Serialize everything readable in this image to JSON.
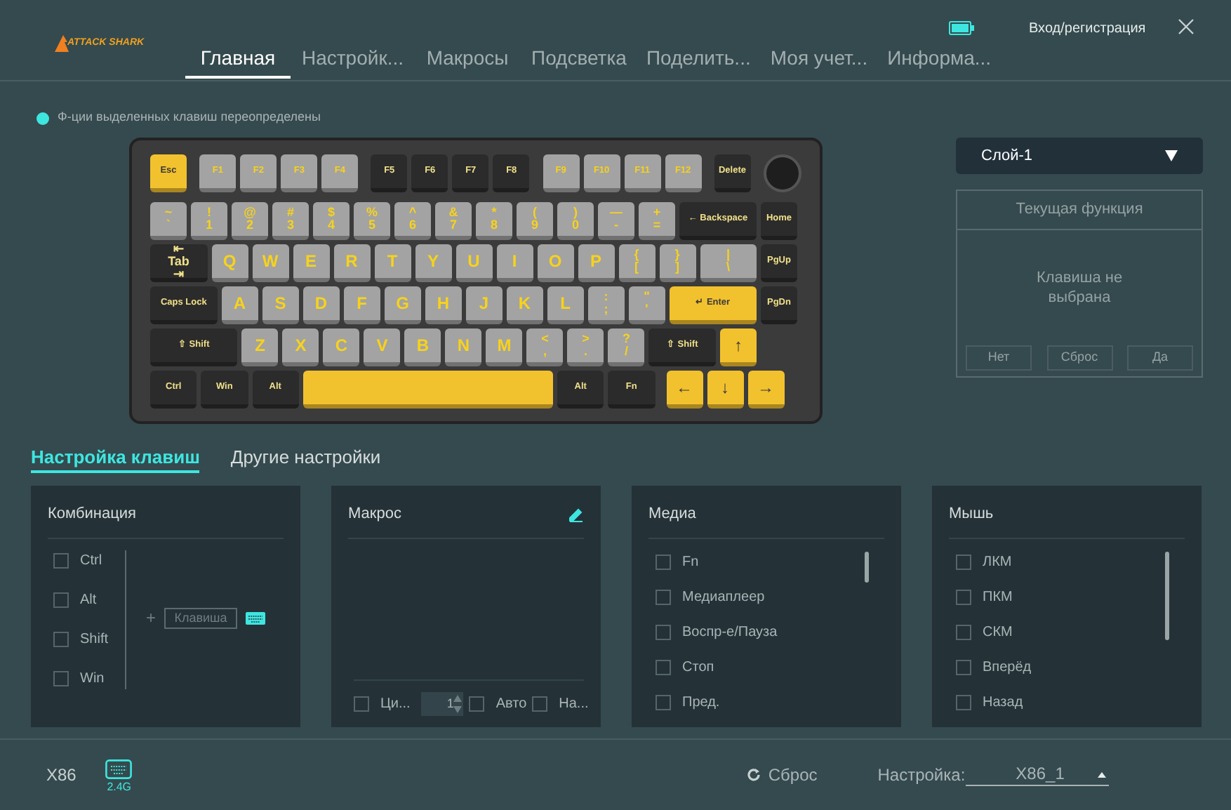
{
  "header": {
    "logo": "ATTACK SHARK",
    "login": "Вход/регистрация",
    "tabs": [
      {
        "label": "Главная",
        "selected": true
      },
      {
        "label": "Настройк...",
        "selected": false
      },
      {
        "label": "Макросы",
        "selected": false
      },
      {
        "label": "Подсветка",
        "selected": false
      },
      {
        "label": "Поделить...",
        "selected": false
      },
      {
        "label": "Моя учет...",
        "selected": false
      },
      {
        "label": "Информа...",
        "selected": false
      }
    ]
  },
  "notice": {
    "text": "Ф-ции выделенных клавиш переопределены",
    "color": "#3ee6e0"
  },
  "keyboard": {
    "rows": [
      {
        "clusters": [
          {
            "keys": [
              {
                "legend": [
                  "Esc"
                ],
                "kind": "standard",
                "color": "#f2c12e"
              }
            ]
          },
          {
            "keys": [
              {
                "legend": [
                  "F1"
                ],
                "kind": "standard",
                "color": "#a3a3a3"
              },
              {
                "legend": [
                  "F2"
                ],
                "kind": "standard",
                "color": "#a3a3a3"
              },
              {
                "legend": [
                  "F3"
                ],
                "kind": "standard",
                "color": "#a3a3a3"
              },
              {
                "legend": [
                  "F4"
                ],
                "kind": "standard",
                "color": "#a3a3a3"
              }
            ]
          },
          {
            "keys": [
              {
                "legend": [
                  "F5"
                ],
                "kind": "standard",
                "color": "#2b2b2b"
              },
              {
                "legend": [
                  "F6"
                ],
                "kind": "standard",
                "color": "#2b2b2b"
              },
              {
                "legend": [
                  "F7"
                ],
                "kind": "standard",
                "color": "#2b2b2b"
              },
              {
                "legend": [
                  "F8"
                ],
                "kind": "standard",
                "color": "#2b2b2b"
              }
            ]
          },
          {
            "keys": [
              {
                "legend": [
                  "F9"
                ],
                "kind": "standard",
                "color": "#a3a3a3"
              },
              {
                "legend": [
                  "F10"
                ],
                "kind": "standard",
                "color": "#a3a3a3"
              },
              {
                "legend": [
                  "F11"
                ],
                "kind": "standard",
                "color": "#a3a3a3"
              },
              {
                "legend": [
                  "F12"
                ],
                "kind": "standard",
                "color": "#a3a3a3"
              }
            ]
          },
          {
            "keys": [
              {
                "legend": [
                  "Delete"
                ],
                "kind": "standard",
                "color": "#2b2b2b"
              }
            ]
          }
        ]
      },
      {
        "clusters": [
          {
            "keys": [
              {
                "legend": [
                  "~",
                  "`"
                ],
                "kind": "standard",
                "color": "#a3a3a3"
              },
              {
                "legend": [
                  "!",
                  "1"
                ],
                "kind": "standard",
                "color": "#a3a3a3"
              },
              {
                "legend": [
                  "@",
                  "2"
                ],
                "kind": "standard",
                "color": "#a3a3a3"
              },
              {
                "legend": [
                  "#",
                  "3"
                ],
                "kind": "standard",
                "color": "#a3a3a3"
              },
              {
                "legend": [
                  "$",
                  "4"
                ],
                "kind": "standard",
                "color": "#a3a3a3"
              },
              {
                "legend": [
                  "%",
                  "5"
                ],
                "kind": "standard",
                "color": "#a3a3a3"
              },
              {
                "legend": [
                  "^",
                  "6"
                ],
                "kind": "standard",
                "color": "#a3a3a3"
              },
              {
                "legend": [
                  "&",
                  "7"
                ],
                "kind": "standard",
                "color": "#a3a3a3"
              },
              {
                "legend": [
                  "*",
                  "8"
                ],
                "kind": "standard",
                "color": "#a3a3a3"
              },
              {
                "legend": [
                  "(",
                  "9"
                ],
                "kind": "standard",
                "color": "#a3a3a3"
              },
              {
                "legend": [
                  ")",
                  "0"
                ],
                "kind": "standard",
                "color": "#a3a3a3"
              },
              {
                "legend": [
                  "—",
                  "-"
                ],
                "kind": "standard",
                "color": "#a3a3a3"
              },
              {
                "legend": [
                  "+",
                  "="
                ],
                "kind": "standard",
                "color": "#a3a3a3"
              },
              {
                "legend": [
                  "← Backspace"
                ],
                "kind": "backspace",
                "color": "#2b2b2b"
              },
              {
                "legend": [
                  "Home"
                ],
                "kind": "standard",
                "color": "#2b2b2b"
              }
            ]
          }
        ]
      },
      {
        "clusters": [
          {
            "keys": [
              {
                "legend": [
                  "⇤",
                  "Tab",
                  "⇥"
                ],
                "kind": "tab",
                "color": "#2b2b2b"
              },
              {
                "legend": [
                  "Q"
                ],
                "kind": "standard",
                "color": "#a3a3a3"
              },
              {
                "legend": [
                  "W"
                ],
                "kind": "standard",
                "color": "#a3a3a3"
              },
              {
                "legend": [
                  "E"
                ],
                "kind": "standard",
                "color": "#a3a3a3"
              },
              {
                "legend": [
                  "R"
                ],
                "kind": "standard",
                "color": "#a3a3a3"
              },
              {
                "legend": [
                  "T"
                ],
                "kind": "standard",
                "color": "#a3a3a3"
              },
              {
                "legend": [
                  "Y"
                ],
                "kind": "standard",
                "color": "#a3a3a3"
              },
              {
                "legend": [
                  "U"
                ],
                "kind": "standard",
                "color": "#a3a3a3"
              },
              {
                "legend": [
                  "I"
                ],
                "kind": "standard",
                "color": "#a3a3a3"
              },
              {
                "legend": [
                  "O"
                ],
                "kind": "standard",
                "color": "#a3a3a3"
              },
              {
                "legend": [
                  "P"
                ],
                "kind": "standard",
                "color": "#a3a3a3"
              },
              {
                "legend": [
                  "{",
                  "["
                ],
                "kind": "standard",
                "color": "#a3a3a3"
              },
              {
                "legend": [
                  "}",
                  "]"
                ],
                "kind": "standard",
                "color": "#a3a3a3"
              },
              {
                "legend": [
                  "|",
                  "\\"
                ],
                "kind": "pipe",
                "color": "#a3a3a3"
              },
              {
                "legend": [
                  "PgUp"
                ],
                "kind": "standard",
                "color": "#2b2b2b"
              }
            ]
          }
        ]
      },
      {
        "clusters": [
          {
            "keys": [
              {
                "legend": [
                  "Caps Lock"
                ],
                "kind": "caps",
                "color": "#2b2b2b"
              },
              {
                "legend": [
                  "A"
                ],
                "kind": "standard",
                "color": "#a3a3a3"
              },
              {
                "legend": [
                  "S"
                ],
                "kind": "standard",
                "color": "#a3a3a3"
              },
              {
                "legend": [
                  "D"
                ],
                "kind": "standard",
                "color": "#a3a3a3"
              },
              {
                "legend": [
                  "F"
                ],
                "kind": "standard",
                "color": "#a3a3a3"
              },
              {
                "legend": [
                  "G"
                ],
                "kind": "standard",
                "color": "#a3a3a3"
              },
              {
                "legend": [
                  "H"
                ],
                "kind": "standard",
                "color": "#a3a3a3"
              },
              {
                "legend": [
                  "J"
                ],
                "kind": "standard",
                "color": "#a3a3a3"
              },
              {
                "legend": [
                  "K"
                ],
                "kind": "standard",
                "color": "#a3a3a3"
              },
              {
                "legend": [
                  "L"
                ],
                "kind": "standard",
                "color": "#a3a3a3"
              },
              {
                "legend": [
                  ":",
                  ";"
                ],
                "kind": "standard",
                "color": "#a3a3a3"
              },
              {
                "legend": [
                  "\"",
                  "'"
                ],
                "kind": "standard",
                "color": "#a3a3a3"
              },
              {
                "legend": [
                  "↵ Enter"
                ],
                "kind": "enter",
                "color": "#f2c12e"
              },
              {
                "legend": [
                  "PgDn"
                ],
                "kind": "standard",
                "color": "#2b2b2b"
              }
            ]
          }
        ]
      },
      {
        "clusters": [
          {
            "keys": [
              {
                "legend": [
                  "⇧ Shift"
                ],
                "kind": "lshift",
                "color": "#2b2b2b"
              },
              {
                "legend": [
                  "Z"
                ],
                "kind": "standard",
                "color": "#a3a3a3"
              },
              {
                "legend": [
                  "X"
                ],
                "kind": "standard",
                "color": "#a3a3a3"
              },
              {
                "legend": [
                  "C"
                ],
                "kind": "standard",
                "color": "#a3a3a3"
              },
              {
                "legend": [
                  "V"
                ],
                "kind": "standard",
                "color": "#a3a3a3"
              },
              {
                "legend": [
                  "B"
                ],
                "kind": "standard",
                "color": "#a3a3a3"
              },
              {
                "legend": [
                  "N"
                ],
                "kind": "standard",
                "color": "#a3a3a3"
              },
              {
                "legend": [
                  "M"
                ],
                "kind": "standard",
                "color": "#a3a3a3"
              },
              {
                "legend": [
                  "<",
                  ","
                ],
                "kind": "standard",
                "color": "#a3a3a3"
              },
              {
                "legend": [
                  ">",
                  "."
                ],
                "kind": "standard",
                "color": "#a3a3a3"
              },
              {
                "legend": [
                  "?",
                  "/"
                ],
                "kind": "standard",
                "color": "#a3a3a3"
              },
              {
                "legend": [
                  "⇧ Shift"
                ],
                "kind": "rshift",
                "color": "#2b2b2b"
              },
              {
                "legend": [
                  "↑"
                ],
                "kind": "standard",
                "color": "#f2c12e"
              }
            ]
          }
        ]
      },
      {
        "clusters": [
          {
            "keys": [
              {
                "legend": [
                  "Ctrl"
                ],
                "kind": "mod",
                "color": "#2b2b2b"
              },
              {
                "legend": [
                  "Win"
                ],
                "kind": "mod",
                "color": "#2b2b2b"
              },
              {
                "legend": [
                  "Alt"
                ],
                "kind": "mod",
                "color": "#2b2b2b"
              },
              {
                "kind": "space",
                "color": "#f2c12e"
              },
              {
                "legend": [
                  "Alt"
                ],
                "kind": "mod",
                "color": "#2b2b2b"
              },
              {
                "legend": [
                  "Fn"
                ],
                "kind": "mod",
                "color": "#2b2b2b"
              }
            ]
          },
          {
            "keys": [
              {
                "legend": [
                  "←"
                ],
                "kind": "standard",
                "color": "#f2c12e"
              },
              {
                "legend": [
                  "↓"
                ],
                "kind": "standard",
                "color": "#f2c12e"
              },
              {
                "legend": [
                  "→"
                ],
                "kind": "standard",
                "color": "#f2c12e"
              }
            ]
          }
        ]
      }
    ]
  },
  "layer_select": {
    "value": "Слой-1"
  },
  "current_function": {
    "title": "Текущая функция",
    "message": "Клавиша не выбрана",
    "buttons": [
      "Нет",
      "Сброс",
      "Да"
    ]
  },
  "settings_tabs": [
    {
      "label": "Настройка клавиш",
      "selected": true
    },
    {
      "label": "Другие настройки",
      "selected": false
    }
  ],
  "combination": {
    "title": "Комбинация",
    "modifiers": [
      {
        "label": "Ctrl",
        "checked": false
      },
      {
        "label": "Alt",
        "checked": false
      },
      {
        "label": "Shift",
        "checked": false
      },
      {
        "label": "Win",
        "checked": false
      }
    ],
    "plus": "+",
    "key_placeholder": "Клавиша"
  },
  "macro": {
    "title": "Макрос",
    "loop": {
      "label": "Ци...",
      "checked": false
    },
    "count": "1",
    "auto": {
      "label": "Авто",
      "checked": false
    },
    "press": {
      "label": "На...",
      "checked": false
    }
  },
  "media": {
    "title": "Медиа",
    "items": [
      {
        "label": "Fn",
        "checked": false
      },
      {
        "label": "Медиаплеер",
        "checked": false
      },
      {
        "label": "Воспр-е/Пауза",
        "checked": false
      },
      {
        "label": "Стоп",
        "checked": false
      },
      {
        "label": "Пред.",
        "checked": false
      }
    ]
  },
  "mouse": {
    "title": "Мышь",
    "items": [
      {
        "label": "ЛКМ",
        "checked": false
      },
      {
        "label": "ПКМ",
        "checked": false
      },
      {
        "label": "СКМ",
        "checked": false
      },
      {
        "label": "Вперёд",
        "checked": false
      },
      {
        "label": "Назад",
        "checked": false
      }
    ]
  },
  "footer": {
    "model": "X86",
    "connection": "2.4G",
    "reset": "Сброс",
    "profile_label": "Настройка:",
    "profile_value": "X86_1"
  }
}
